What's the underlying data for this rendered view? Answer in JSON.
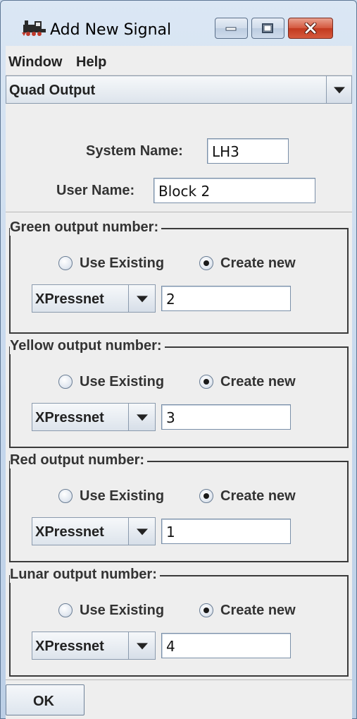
{
  "window": {
    "title": "Add New Signal",
    "icon": "locomotive-icon",
    "controls": [
      "minimize-icon",
      "maximize-icon",
      "close-icon"
    ]
  },
  "menu": {
    "items": [
      {
        "label": "Window"
      },
      {
        "label": "Help"
      }
    ]
  },
  "signal_type": {
    "selected": "Quad Output"
  },
  "system_name": {
    "label": "System Name:",
    "value": "LH3"
  },
  "user_name": {
    "label": "User Name:",
    "value": "Block 2"
  },
  "outputs": [
    {
      "title": "Green output number:",
      "radio_existing": "Use Existing",
      "radio_new": "Create new",
      "selected_radio": "Create new",
      "system": "XPressnet",
      "number": "2"
    },
    {
      "title": "Yellow output number:",
      "radio_existing": "Use Existing",
      "radio_new": "Create new",
      "selected_radio": "Create new",
      "system": "XPressnet",
      "number": "3"
    },
    {
      "title": "Red output number:",
      "radio_existing": "Use Existing",
      "radio_new": "Create new",
      "selected_radio": "Create new",
      "system": "XPressnet",
      "number": "1"
    },
    {
      "title": "Lunar output number:",
      "radio_existing": "Use Existing",
      "radio_new": "Create new",
      "selected_radio": "Create new",
      "system": "XPressnet",
      "number": "4"
    }
  ],
  "ok_button": {
    "label": "OK"
  },
  "colors": {
    "close_button": "#c2391f",
    "window_frame": "#c5d7ec",
    "panel_background": "#eeeeee"
  }
}
